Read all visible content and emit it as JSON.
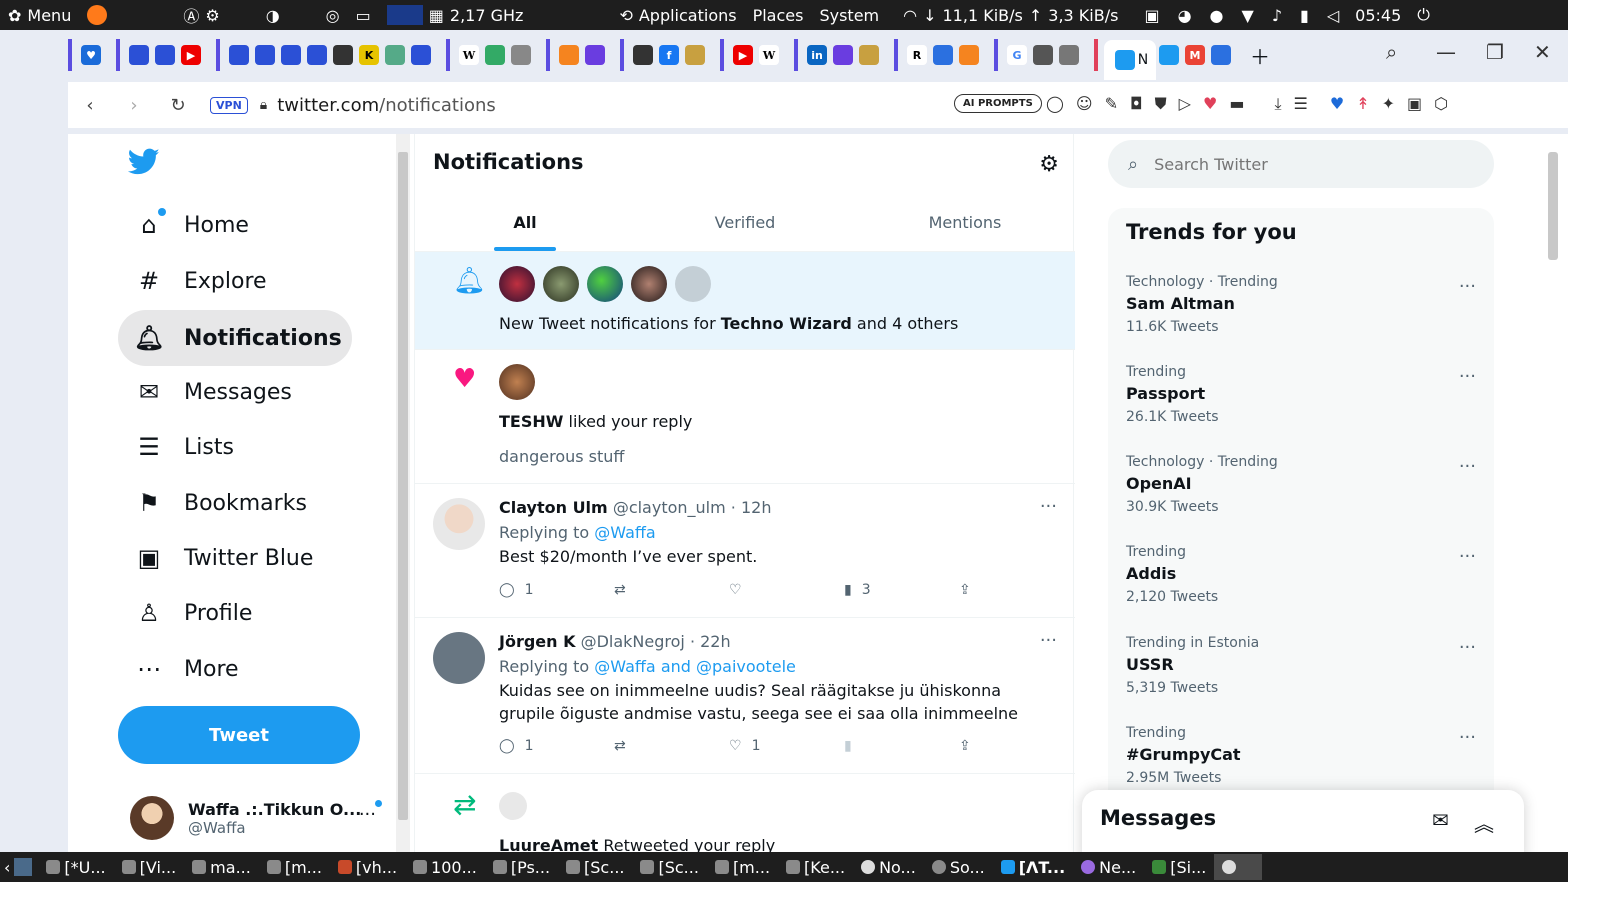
{
  "os_top": {
    "menu_label": "Menu",
    "cpu_freq": "2,17 GHz",
    "applications": "Applications",
    "places": "Places",
    "system": "System",
    "net_down": "11,1 KiB/s",
    "net_up": "3,3 KiB/s",
    "clock": "05:45"
  },
  "browser": {
    "vpn_label": "VPN",
    "url_host": "twitter.com",
    "url_path": "/notifications",
    "ai_prompts": "AI PROMPTS",
    "active_tab_letter": "N"
  },
  "nav": {
    "items": [
      {
        "label": "Home",
        "icon": "home-icon"
      },
      {
        "label": "Explore",
        "icon": "hashtag-icon"
      },
      {
        "label": "Notifications",
        "icon": "bell-icon"
      },
      {
        "label": "Messages",
        "icon": "envelope-icon"
      },
      {
        "label": "Lists",
        "icon": "list-icon"
      },
      {
        "label": "Bookmarks",
        "icon": "bookmark-icon"
      },
      {
        "label": "Twitter Blue",
        "icon": "twitter-blue-icon"
      },
      {
        "label": "Profile",
        "icon": "person-icon"
      },
      {
        "label": "More",
        "icon": "more-circle-icon"
      }
    ],
    "tweet_button": "Tweet",
    "account_name": "Waffa .:.Tikkun O...",
    "account_handle": "@Waffa"
  },
  "main": {
    "title": "Notifications",
    "tabs": [
      "All",
      "Verified",
      "Mentions"
    ],
    "notif1": {
      "text_pre": "New Tweet notifications for ",
      "text_bold": "Techno Wizard",
      "text_post": " and 4 others"
    },
    "notif2": {
      "actor": "TESHW",
      "action": " liked your reply",
      "snippet": "dangerous stuff"
    },
    "tweet1": {
      "name": "Clayton Ulm",
      "handle": "@clayton_ulm",
      "time": "· 12h",
      "replying_prefix": "Replying to ",
      "replying_to": "@Waffa",
      "body": "Best $20/month I’ve ever spent.",
      "replies": "1",
      "retweets": "",
      "likes": "",
      "views": "3"
    },
    "tweet2": {
      "name": "Jörgen K",
      "handle": "@DlakNegroj",
      "time": "· 22h",
      "replying_prefix": "Replying to ",
      "replying_to": "@Waffa and @paivootele",
      "body": "Kuidas see on inimmeelne uudis? Seal räägitakse ju ühiskonna grupile õiguste andmise vastu, seega see ei saa olla inimmeelne",
      "replies": "1",
      "retweets": "",
      "likes": "1",
      "views": ""
    },
    "notif3": {
      "actor": "LuureAmet",
      "action": " Retweeted your reply"
    }
  },
  "right": {
    "search_placeholder": "Search Twitter",
    "trends_title": "Trends for you",
    "trends": [
      {
        "context": "Technology · Trending",
        "name": "Sam Altman",
        "count": "11.6K Tweets"
      },
      {
        "context": "Trending",
        "name": "Passport",
        "count": "26.1K Tweets"
      },
      {
        "context": "Technology · Trending",
        "name": "OpenAI",
        "count": "30.9K Tweets"
      },
      {
        "context": "Trending",
        "name": "Addis",
        "count": "2,120 Tweets"
      },
      {
        "context": "Trending in Estonia",
        "name": "USSR",
        "count": "5,319 Tweets"
      },
      {
        "context": "Trending",
        "name": "#GrumpyCat",
        "count": "2.95M Tweets"
      }
    ],
    "messages_title": "Messages"
  },
  "taskbar": {
    "items": [
      "[*U...",
      "[Vi...",
      "ma...",
      "[m...",
      "[vh...",
      "100...",
      "[Ps...",
      "[Sc...",
      "[Sc...",
      "[m...",
      "[Ke...",
      "No...",
      "So...",
      "[ΛT...",
      "Ne...",
      "[Si..."
    ]
  },
  "colors": {
    "twitter_blue": "#1d9bf0",
    "like_pink": "#f91880",
    "retweet_green": "#00ba7c"
  }
}
